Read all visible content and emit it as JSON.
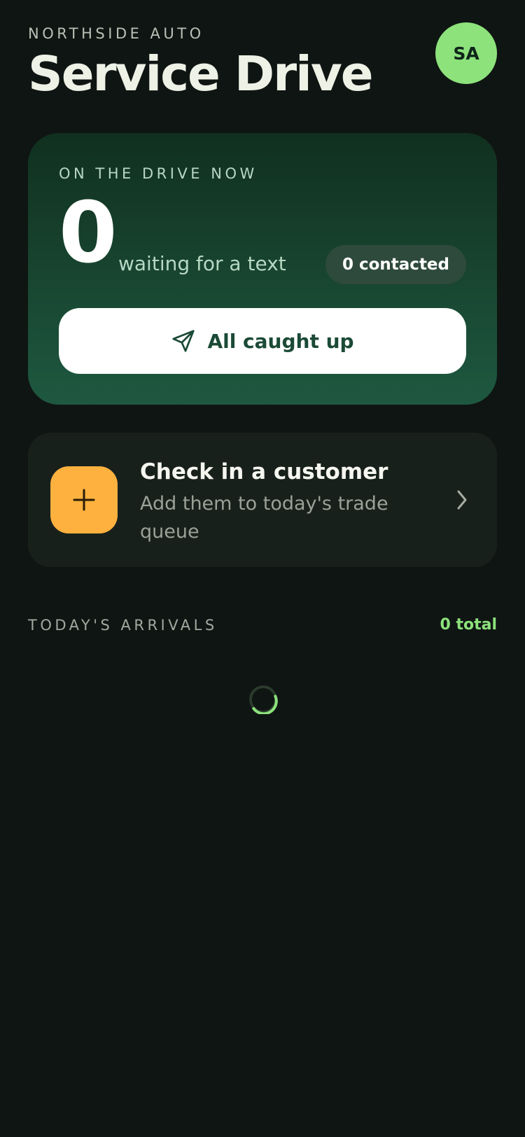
{
  "header": {
    "org_name": "NORTHSIDE AUTO",
    "title": "Service Drive",
    "avatar_initials": "SA"
  },
  "drive": {
    "label": "ON THE DRIVE NOW",
    "waiting_count": "0",
    "waiting_text": "waiting for a text",
    "contacted_badge": "0 contacted",
    "button_label": "All caught up",
    "button_icon": "send-icon"
  },
  "checkin": {
    "title": "Check in a customer",
    "subtitle": "Add them to today's trade queue",
    "icon": "plus-icon",
    "chevron_icon": "chevron-right-icon"
  },
  "arrivals": {
    "label": "TODAY'S ARRIVALS",
    "total": "0 total",
    "loading_icon": "loading-spinner"
  },
  "colors": {
    "background": "#0f1512",
    "accent_green": "#8de27c",
    "card_gradient_top": "#11301f",
    "card_gradient_bottom": "#1e5840",
    "checkin_accent": "#ffb13f"
  }
}
